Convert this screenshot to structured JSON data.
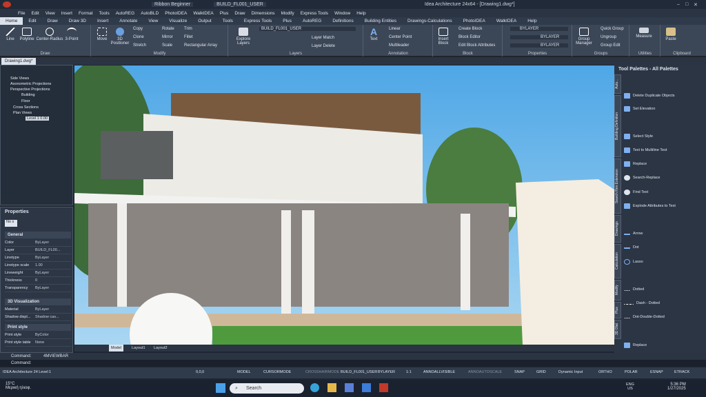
{
  "title": {
    "quick_access": "Ribbon Beginner",
    "layer_combo": "BUILD_FL001_USER",
    "window_title": "Idea Architecture 24x64 - [Drawing1.dwg*]"
  },
  "menu": [
    "File",
    "Edit",
    "View",
    "Insert",
    "Format",
    "Tools",
    "AutoREG",
    "AutoBLD",
    "PhotoIDEA",
    "WalkIDEA",
    "Plus",
    "Draw",
    "Dimensions",
    "Modify",
    "Express Tools",
    "Window",
    "Help"
  ],
  "ribbon_tabs": [
    "Home",
    "Edit",
    "Draw",
    "Draw 3D",
    "Insert",
    "Annotate",
    "View",
    "Visualize",
    "Output",
    "Tools",
    "Express Tools",
    "Plus",
    "AutoREG",
    "Definitions",
    "Building Entities",
    "Drawings-Calculations",
    "PhotoIDEA",
    "WalkIDEA",
    "Help"
  ],
  "ribbon": {
    "draw": {
      "label": "Draw",
      "line": "Line",
      "polyline": "Polyline",
      "circle": "Center-Radius",
      "arc": "3-Point"
    },
    "modify": {
      "label": "Modify",
      "move": "Move",
      "positioner": "3D Positioner",
      "copy": "Copy",
      "rotate": "Rotate",
      "trim": "Trim",
      "clone": "Clone",
      "mirror": "Mirror",
      "fillet": "Fillet",
      "stretch": "Stretch",
      "scale": "Scale",
      "array": "Rectangular Array"
    },
    "layers": {
      "label": "Layers",
      "explore": "Explore Layers",
      "combo": "BUILD_FL001_USER",
      "match": "Layer Match",
      "delete": "Layer Delete"
    },
    "annotation": {
      "label": "Annotation",
      "text": "Text",
      "linear": "Linear",
      "center": "Center Point",
      "multileader": "Multileader"
    },
    "block": {
      "label": "Block",
      "insert": "Insert Block",
      "create": "Create Block",
      "editor": "Block Editor",
      "attributes": "Edit Block Attributes"
    },
    "properties": {
      "label": "Properties",
      "bylayer1": "BYLAYER",
      "bylayer2": "BYLAYER",
      "bylayer3": "BYLAYER"
    },
    "groups": {
      "label": "Groups",
      "manager": "Group Manager",
      "quick": "Quick Group",
      "ungroup": "Ungroup",
      "edit": "Group Edit"
    },
    "utilities": {
      "label": "Utilities",
      "measure": "Measure"
    },
    "clipboard": {
      "label": "Clipboard",
      "paste": "Paste"
    }
  },
  "doc_tab": "Drawing1.dwg*",
  "tree": [
    "Side Views",
    "Axonometric Projections",
    "Perspective Projections",
    "Building",
    "Floor",
    "Cross Sections",
    "Plan Views",
    "Level 1  0.00"
  ],
  "properties": {
    "title": "Properties",
    "selector": "No s",
    "general": {
      "label": "General",
      "rows": [
        [
          "Color",
          "ByLayer"
        ],
        [
          "Layer",
          "BUILD_FL00..."
        ],
        [
          "Linetype",
          "ByLayer"
        ],
        [
          "Linetype scale",
          "1.00"
        ],
        [
          "Lineweight",
          "ByLayer"
        ],
        [
          "Thickness",
          "0"
        ],
        [
          "Transparency",
          "ByLayer"
        ]
      ]
    },
    "viz": {
      "label": "3D Visualization",
      "rows": [
        [
          "Material",
          "ByLayer"
        ],
        [
          "Shadow displ...",
          "Shadow cas..."
        ]
      ]
    },
    "print": {
      "label": "Print style",
      "rows": [
        [
          "Print style",
          "ByColor"
        ],
        [
          "Print style table",
          "None"
        ]
      ]
    }
  },
  "layout_tabs": [
    "Model",
    "Layout1",
    "Layout2"
  ],
  "palette": {
    "title": "Tool Palettes - All Palettes",
    "items": [
      "Delete Duplicate Objects",
      "Set Elevation",
      "Select Style",
      "Text to Multiline Text",
      "Replace",
      "Search-Replace",
      "Find Text",
      "Explode Attributes to Text",
      "Arrow",
      "Dot",
      "Lasso",
      "Dotted",
      "Dash - Dotted",
      "Dot-Double-Dotted",
      "Replace"
    ],
    "side_tabs": [
      "Auto...",
      "Building Definition",
      "Search Ren Extension",
      "Drawings",
      "Calculation",
      "Modify",
      "Plus",
      "3D Olat"
    ]
  },
  "command": {
    "line1_label": "Command:",
    "line1_value": "4MVIEWBAR",
    "line2_label": "Command:"
  },
  "status": {
    "left": "IDEA Architecture 24 Level:1",
    "coords": "0,0,0",
    "model": "MODEL",
    "cursormode": "CURSORMODE",
    "crosshair": "CROSSHAIRMODE",
    "layer": "BUILD_FL001_USER",
    "bylayer": "BYLAYER",
    "scale": "1:1",
    "annovis": "ANNOALLVISIBLE",
    "annoscale": "ANNOAUTOSCALE",
    "snap": "SNAP",
    "grid": "GRID",
    "dyn": "Dynamic Input",
    "ortho": "ORTHO",
    "polar": "POLAR",
    "esnap": "ESNAP",
    "etrack": "ETRACK"
  },
  "taskbar": {
    "temp": "15°C",
    "weather": "Μερική ηλιοφ.",
    "search": "Search",
    "lang1": "ENG",
    "lang2": "US",
    "time": "5:36 PM",
    "date": "1/27/2025"
  },
  "colors": {
    "accent": "#3f7fd0",
    "ribbon": "#3b4656",
    "panel": "#2b3544"
  }
}
